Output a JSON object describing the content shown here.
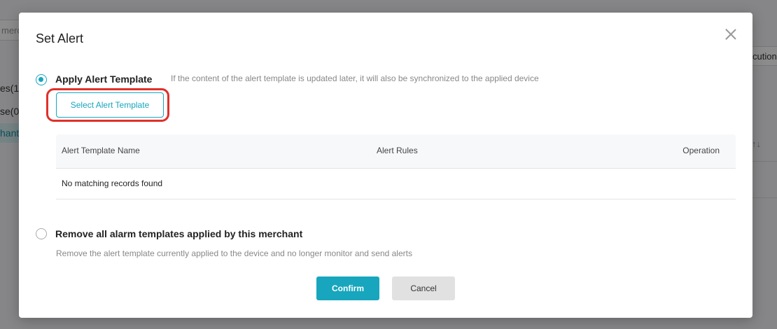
{
  "background": {
    "search_partial": "merc",
    "side_items": [
      "es(1)",
      "se(0)",
      "hant"
    ],
    "right_button_partial": "cution",
    "right_sort_glyph": "↑↓"
  },
  "modal": {
    "title": "Set Alert",
    "close_icon": "close-icon",
    "option_apply": {
      "label": "Apply Alert Template",
      "hint": "If the content of the alert template is updated later, it will also be synchronized to the applied device",
      "checked": true,
      "select_button": "Select Alert Template"
    },
    "table": {
      "columns": [
        "Alert Template Name",
        "Alert Rules",
        "Operation"
      ],
      "empty_text": "No matching records found"
    },
    "option_remove": {
      "label": "Remove all alarm templates applied by this merchant",
      "hint": "Remove the alert template currently applied to the device and no longer monitor and send alerts",
      "checked": false
    },
    "buttons": {
      "confirm": "Confirm",
      "cancel": "Cancel"
    }
  },
  "colors": {
    "accent": "#17a6bd",
    "highlight": "#e0302a"
  }
}
